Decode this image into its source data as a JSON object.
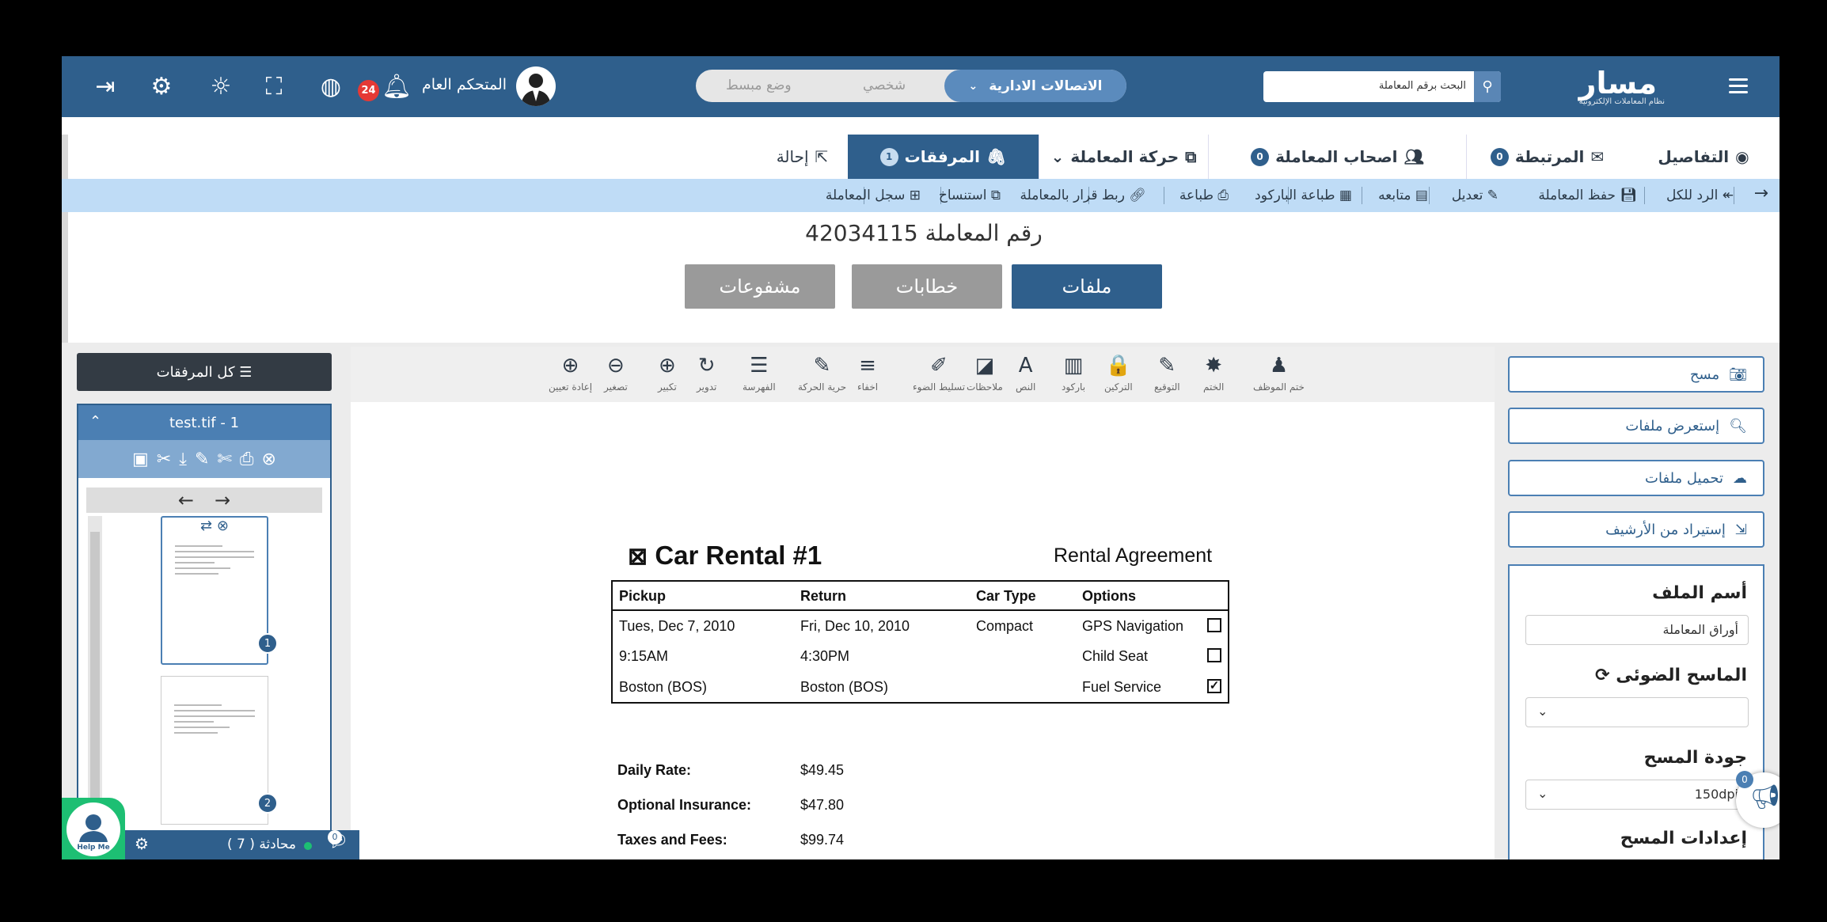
{
  "brand": {
    "logo": "مسار",
    "slogan": "نظام المعاملات الإلكترونية"
  },
  "header": {
    "search_placeholder": "البحث برقم المعاملة",
    "mode": {
      "active": "الاتصالات الادارية",
      "option_personal": "شخصي",
      "option_simple": "وضع مبسط"
    },
    "user_name": "المتحكم العام",
    "notifications_count": "24"
  },
  "tabs": [
    {
      "label": "التفاصيل"
    },
    {
      "label": "المرتبطة",
      "count": "0"
    },
    {
      "label": "اصحاب المعاملة",
      "count": "0"
    },
    {
      "label": "حركة المعاملة"
    },
    {
      "label": "المرفقات",
      "count": "1"
    },
    {
      "label": "إحالة"
    }
  ],
  "actions": [
    "الرد للكل",
    "حفظ المعاملة",
    "تعديل",
    "متابعه",
    "طباعة الباركود",
    "طباعة",
    "ربط قرار بالمعاملة",
    "استنساخ",
    "سجل المعاملة"
  ],
  "transaction": {
    "title": "رقم المعاملة 42034115",
    "buttons": [
      "ملفات",
      "خطابات",
      "مشفوعات"
    ]
  },
  "left_panel": {
    "all_attachments": "كل المرفقات",
    "file_title": "test.tif - 1",
    "pages": [
      "1",
      "2"
    ]
  },
  "viewer_tools": [
    {
      "icon": "reset-icon",
      "label": "إعادة تعيين",
      "glyph": "⊕"
    },
    {
      "icon": "zoom-out-icon",
      "label": "تصغير",
      "glyph": "⊖"
    },
    {
      "icon": "zoom-in-icon",
      "label": "تكبير",
      "glyph": "⊕"
    },
    {
      "icon": "rotate-icon",
      "label": "تدوير",
      "glyph": "↻"
    },
    {
      "icon": "index-icon",
      "label": "الفهرسة",
      "glyph": "☰"
    },
    {
      "icon": "free-move-icon",
      "label": "حرية الحركة",
      "glyph": "✎"
    },
    {
      "icon": "hide-icon",
      "label": "اخفاء",
      "glyph": "≡"
    },
    {
      "icon": "highlight-icon",
      "label": "تسليط الضوء",
      "glyph": "✐"
    },
    {
      "icon": "notes-icon",
      "label": "ملاحظات",
      "glyph": "◪"
    },
    {
      "icon": "text-icon",
      "label": "النص",
      "glyph": "A"
    },
    {
      "icon": "barcode-icon",
      "label": "باركود",
      "glyph": "▥"
    },
    {
      "icon": "lock-icon",
      "label": "التركين",
      "glyph": "🔒"
    },
    {
      "icon": "signature-icon",
      "label": "التوقيع",
      "glyph": "✎"
    },
    {
      "icon": "seal-icon",
      "label": "الختم",
      "glyph": "✸"
    },
    {
      "icon": "employee-stamp-icon",
      "label": "ختم الموظف",
      "glyph": "♟"
    }
  ],
  "document": {
    "title": "Car Rental #1",
    "subtitle": "Rental Agreement",
    "headers": [
      "Pickup",
      "Return",
      "Car Type",
      "Options"
    ],
    "rows": [
      [
        "Tues, Dec 7, 2010",
        "Fri, Dec 10, 2010",
        "Compact",
        "GPS Navigation"
      ],
      [
        "9:15AM",
        "4:30PM",
        "",
        "Child Seat"
      ],
      [
        "Boston (BOS)",
        "Boston (BOS)",
        "",
        "Fuel Service"
      ]
    ],
    "options_checked": [
      false,
      false,
      true
    ],
    "rates": [
      {
        "label": "Daily Rate:",
        "value": "$49.45"
      },
      {
        "label": "Optional Insurance:",
        "value": "$47.80"
      },
      {
        "label": "Taxes and Fees:",
        "value": "$99.74"
      }
    ]
  },
  "right_panel": {
    "scan": "مسح",
    "browse": "إستعرض ملفات",
    "upload": "تحميل ملفات",
    "import": "إستيراد من الأرشيف",
    "file_name_label": "أسم الملف",
    "file_name_value": "أوراق المعاملة",
    "scanner_label": "الماسح الضوئى",
    "scan_quality_label": "جودة المسح",
    "scan_quality_value": "150dpi",
    "scan_settings_label": "إعدادات المسح"
  },
  "footer": {
    "chat_label": "محادثة ( 7 )",
    "chat_badge": "0",
    "help": "Help Me",
    "megaphone_badge": "0"
  },
  "colors": {
    "primary": "#2f5f8c",
    "accent": "#4b7fb3",
    "action_bar": "#bfdcf6",
    "badge": "#e53935"
  }
}
